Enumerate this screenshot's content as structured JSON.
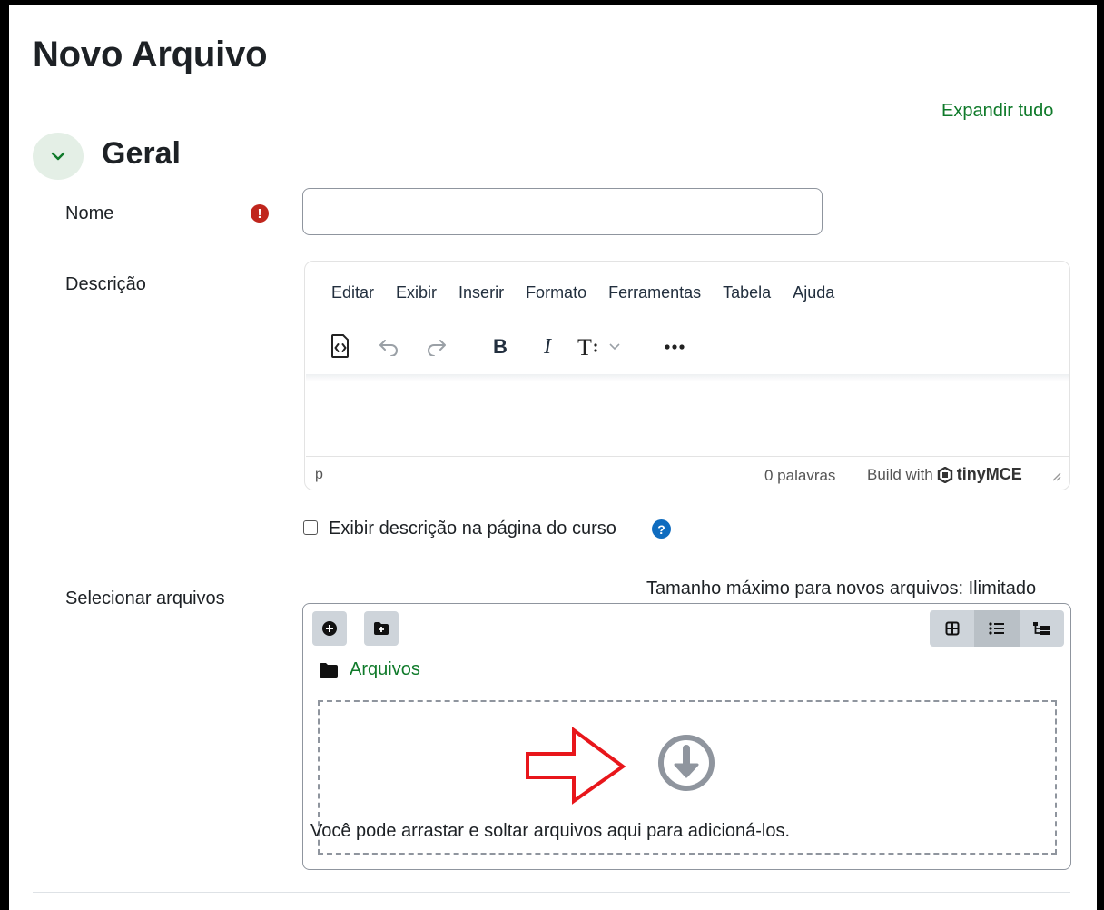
{
  "page": {
    "title": "Novo Arquivo",
    "expand_all": "Expandir tudo"
  },
  "section": {
    "title": "Geral"
  },
  "fields": {
    "name_label": "Nome",
    "name_value": "",
    "description_label": "Descrição",
    "select_files_label": "Selecionar arquivos"
  },
  "editor": {
    "menu": [
      "Editar",
      "Exibir",
      "Inserir",
      "Formato",
      "Ferramentas",
      "Tabela",
      "Ajuda"
    ],
    "toolbar_icons": [
      "source-code-icon",
      "undo-icon",
      "redo-icon",
      "bold-icon",
      "italic-icon",
      "text-size-icon",
      "more-icon"
    ],
    "bold_glyph": "B",
    "italic_glyph": "I",
    "status_path": "p",
    "word_count": "0 palavras",
    "powered_by": "Build with",
    "brand": "tinyMCE"
  },
  "checkbox": {
    "label": "Exibir descrição na página do curso",
    "checked": false
  },
  "filepicker": {
    "max_size": "Tamanho máximo para novos arquivos: Ilimitado",
    "folder": "Arquivos",
    "drop_text": "Você pode arrastar e soltar arquivos aqui para adicioná-los.",
    "view_modes": [
      "grid-view-icon",
      "list-view-icon",
      "tree-view-icon"
    ],
    "active_view": "list-view-icon"
  },
  "colors": {
    "accent": "#0f7a2a",
    "required": "#c0261d",
    "help": "#0f6cbf",
    "annotation_arrow": "#e8161b"
  }
}
